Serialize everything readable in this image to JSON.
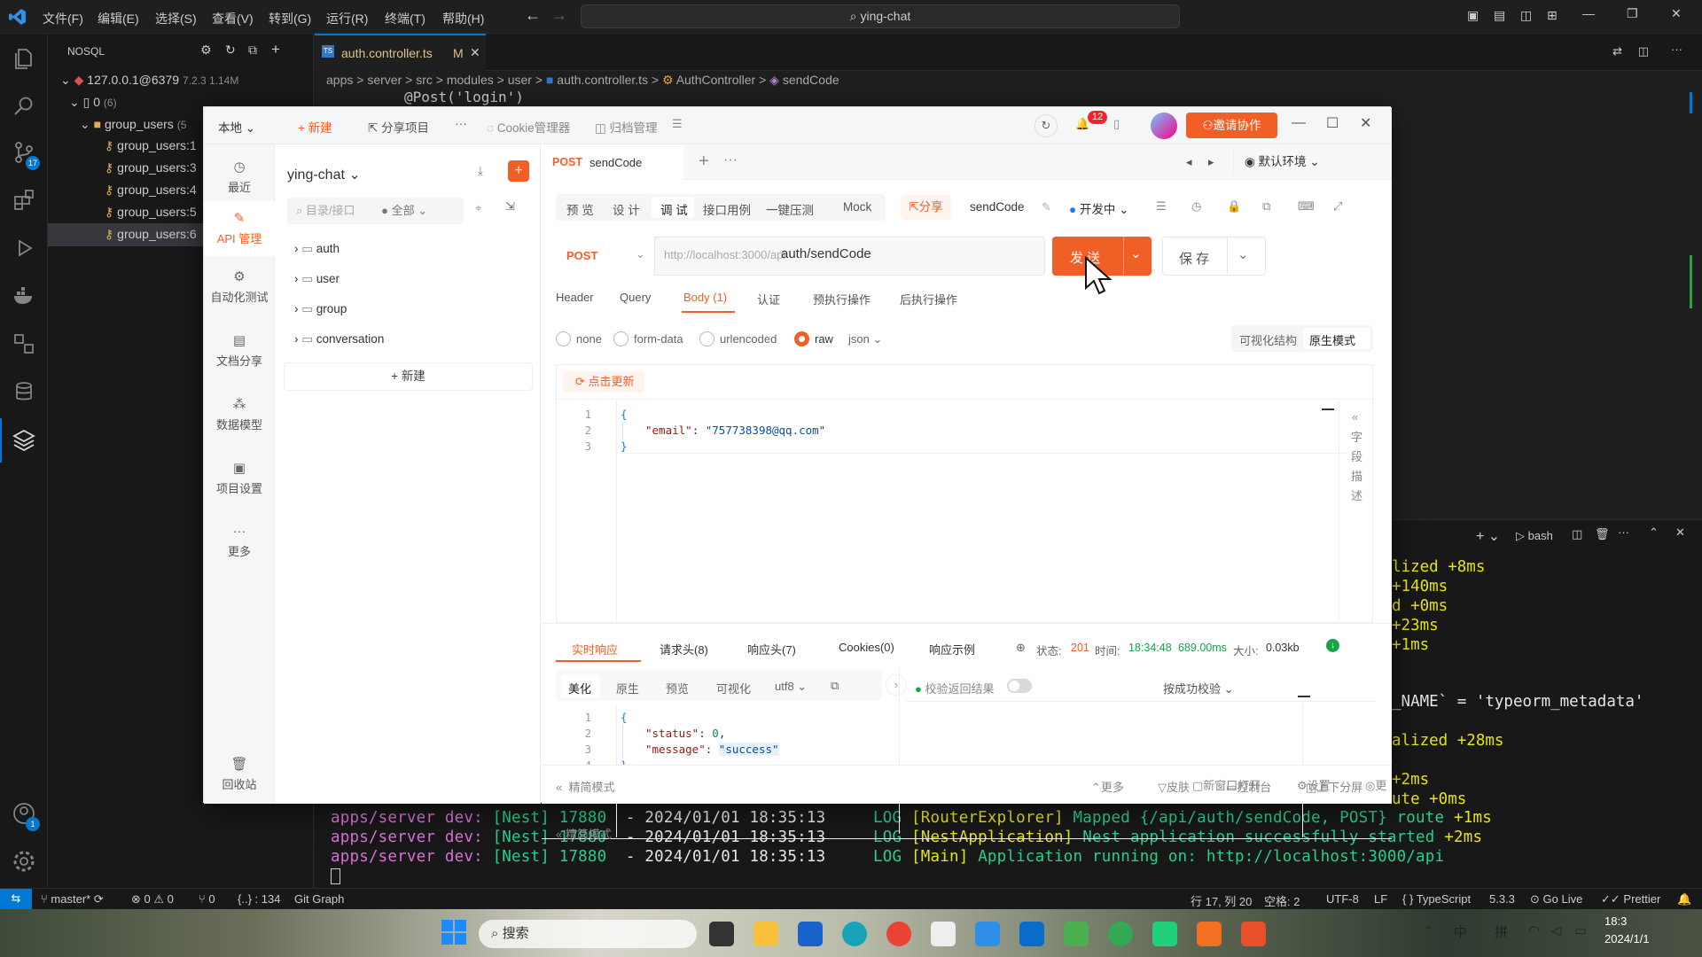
{
  "vscode": {
    "menus": [
      "文件(F)",
      "编辑(E)",
      "选择(S)",
      "查看(V)",
      "转到(G)",
      "运行(R)",
      "终端(T)",
      "帮助(H)"
    ],
    "search": "ying-chat",
    "sidebar": {
      "title": "NOSQL",
      "connection": "127.0.0.1@6379",
      "conn_meta": "7.2.3 1.14M",
      "db": "0",
      "db_count": "(6)",
      "group": "group_users",
      "group_count": "(5",
      "keys": [
        "group_users:1",
        "group_users:3",
        "group_users:4",
        "group_users:5",
        "group_users:6"
      ]
    },
    "tab": {
      "label": "auth.controller.ts",
      "modified": "M"
    },
    "breadcrumbs": [
      "apps",
      ">",
      "server",
      ">",
      "src",
      ">",
      "modules",
      ">",
      "user",
      ">",
      "auth.controller.ts",
      ">",
      "AuthController",
      ">",
      "sendCode"
    ],
    "editor_peek": "@Post('login')",
    "badges": {
      "scm": "17",
      "account": "1"
    },
    "terminal": {
      "shell": "bash",
      "right": [
        "lized +8ms",
        "+140ms",
        "d +0ms",
        "+23ms",
        "+1ms",
        "",
        "_NAME` = 'typeorm_metadata'",
        "",
        "alized +28ms",
        "",
        "+2ms",
        "ute +0ms"
      ],
      "lines": [
        {
          "app": "apps/server",
          "dev": "dev:",
          "nest": "[Nest] 17880",
          "ts": "- 2024/01/01 18:35:13",
          "log": "LOG",
          "ctx": "[RouterExplorer]",
          "msg": "Mapped {/api/auth/sendCode, POST} route",
          "ms": "+1ms"
        },
        {
          "app": "apps/server",
          "dev": "dev:",
          "nest": "[Nest] 17880",
          "ts": "- 2024/01/01 18:35:13",
          "log": "LOG",
          "ctx": "[NestApplication]",
          "msg": "Nest application successfully started",
          "ms": "+2ms"
        },
        {
          "app": "apps/server",
          "dev": "dev:",
          "nest": "[Nest] 17880",
          "ts": "- 2024/01/01 18:35:13",
          "log": "LOG",
          "ctx": "[Main]",
          "msg": "Application running on: http://localhost:3000/api",
          "ms": ""
        }
      ]
    },
    "status": {
      "branch": "master*",
      "errors": "0",
      "warnings": "0",
      "ports": "0",
      "braces": "{..} : 134",
      "gitgraph": "Git Graph",
      "position": "行 17, 列 20",
      "spaces": "空格: 2",
      "encoding": "UTF-8",
      "eol": "LF",
      "lang": "TypeScript",
      "version": "5.3.3",
      "golive": "Go Live",
      "prettier": "Prettier"
    }
  },
  "taskbar": {
    "search": "搜索",
    "time": "18:3",
    "date": "2024/1/1",
    "ime1": "中",
    "ime2": "拼"
  },
  "apifox": {
    "workspace": "本地",
    "new": "新建",
    "share_project": "分享项目",
    "more": "···",
    "cookie": "Cookie管理器",
    "archive": "归档管理",
    "notif": "12",
    "invite": "邀请协作",
    "nav": [
      "最近",
      "API 管理",
      "自动化测试",
      "文档分享",
      "数据模型",
      "项目设置",
      "更多",
      "回收站"
    ],
    "project": "ying-chat",
    "tree_search": "目录/接口",
    "tree_filter": "全部",
    "folders": [
      "auth",
      "user",
      "group",
      "conversation"
    ],
    "tree_new": "新建",
    "req_tab": {
      "method": "POST",
      "name": "sendCode"
    },
    "env": "默认环境",
    "mode_tabs": [
      "预 览",
      "设 计",
      "调 试",
      "接口用例",
      "一键压测",
      "Mock"
    ],
    "share": "分享",
    "endpoint_name": "sendCode",
    "status": "开发中",
    "method": "POST",
    "base": "http://localhost:3000/api",
    "path": "auth/sendCode",
    "send": "发 送",
    "save": "保 存",
    "param_tabs": [
      "Header",
      "Query",
      "Body (1)",
      "认证",
      "预执行操作",
      "后执行操作"
    ],
    "body_types": [
      "none",
      "form-data",
      "urlencoded",
      "raw"
    ],
    "format": "json",
    "view_modes": [
      "可视化结构",
      "原生模式"
    ],
    "refresh": "点击更新",
    "body_code": {
      "key": "\"email\"",
      "value": "\"757738398@qq.com\""
    },
    "field_desc": [
      "字",
      "段",
      "描",
      "述"
    ],
    "resp_tabs": [
      "实时响应",
      "请求头(8)",
      "响应头(7)",
      "Cookies(0)",
      "响应示例"
    ],
    "resp_status": {
      "label": "状态:",
      "code": "201",
      "time_label": "时间:",
      "time": "18:34:48",
      "duration": "689.00ms",
      "size_label": "大小:",
      "size": "0.03kb"
    },
    "resp_view": [
      "美化",
      "原生",
      "预览",
      "可视化"
    ],
    "resp_enc": "utf8",
    "resp_code": {
      "status_key": "\"status\"",
      "status_val": "0",
      "msg_key": "\"message\"",
      "msg_val": "\"success\""
    },
    "validate": "校验返回结果",
    "validate_mode": "按成功校验",
    "footer": [
      "精简模式",
      "更多",
      "皮肤",
      "控制台",
      "上下分屏",
      "新窗口打开",
      "设置",
      "更"
    ]
  }
}
